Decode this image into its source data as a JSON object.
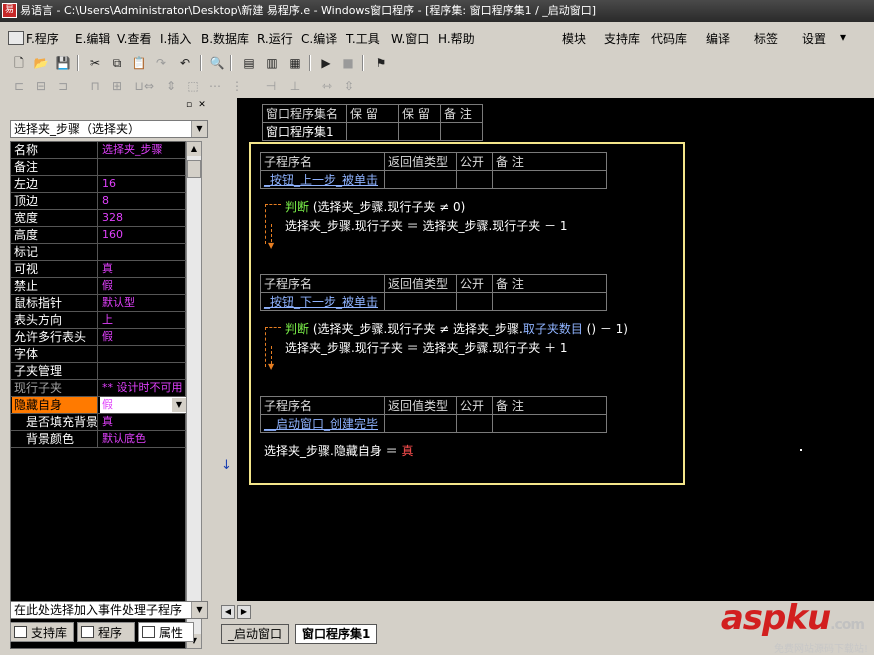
{
  "window": {
    "title": "易语言 - C:\\Users\\Administrator\\Desktop\\新建 易程序.e - Windows窗口程序 - [程序集: 窗口程序集1 / _启动窗口]",
    "app_icon": "易"
  },
  "menu": {
    "items": [
      {
        "label": "F.程序"
      },
      {
        "label": "E.编辑"
      },
      {
        "label": "V.查看"
      },
      {
        "label": "I.插入"
      },
      {
        "label": "B.数据库"
      },
      {
        "label": "R.运行"
      },
      {
        "label": "C.编译"
      },
      {
        "label": "T.工具"
      },
      {
        "label": "W.窗口"
      },
      {
        "label": "H.帮助"
      }
    ],
    "right_items": [
      {
        "label": "模块"
      },
      {
        "label": "支持库"
      },
      {
        "label": "代码库"
      },
      {
        "label": "编译"
      },
      {
        "label": "标签"
      },
      {
        "label": "设置"
      },
      {
        "label": "▾"
      }
    ]
  },
  "property_panel": {
    "object_selector": "选择夹_步骤（选择夹）",
    "rows": [
      {
        "key": "名称",
        "value": "选择夹_步骤"
      },
      {
        "key": "备注",
        "value": ""
      },
      {
        "key": "左边",
        "value": "16"
      },
      {
        "key": "顶边",
        "value": "8"
      },
      {
        "key": "宽度",
        "value": "328"
      },
      {
        "key": "高度",
        "value": "160"
      },
      {
        "key": "标记",
        "value": ""
      },
      {
        "key": "可视",
        "value": "真"
      },
      {
        "key": "禁止",
        "value": "假"
      },
      {
        "key": "鼠标指针",
        "value": "默认型"
      },
      {
        "key": "表头方向",
        "value": "上"
      },
      {
        "key": "允许多行表头",
        "value": "假"
      },
      {
        "key": "字体",
        "value": ""
      },
      {
        "key": "子夹管理",
        "value": ""
      },
      {
        "key": "现行子夹",
        "value": "** 设计时不可用"
      },
      {
        "key": "隐藏自身",
        "value": "假"
      },
      {
        "key": "是否填充背景",
        "value": "真"
      },
      {
        "key": "背景颜色",
        "value": "默认底色"
      }
    ],
    "event_selector": "在此处选择加入事件处理子程序",
    "tabs": [
      {
        "label": "支持库"
      },
      {
        "label": "程序"
      },
      {
        "label": "属性"
      }
    ]
  },
  "editor": {
    "assembly_table": {
      "headers": [
        "窗口程序集名",
        "保 留",
        "保 留",
        "备 注"
      ],
      "row": [
        "窗口程序集1",
        "",
        "",
        ""
      ]
    },
    "sub_header": [
      "子程序名",
      "返回值类型",
      "公开",
      "备 注"
    ],
    "subs": [
      {
        "name": "_按钮_上一步_被单击",
        "line1": {
          "kw": "判断",
          "rest": " (选择夹_步骤.现行子夹 ≠ 0)"
        },
        "line2": "选择夹_步骤.现行子夹 ＝ 选择夹_步骤.现行子夹 － 1"
      },
      {
        "name": "_按钮_下一步_被单击",
        "line1": {
          "kw": "判断",
          "rest_a": " (选择夹_步骤.现行子夹 ≠ 选择夹_步骤.",
          "fn": "取子夹数目",
          "rest_b": " () － 1)"
        },
        "line2": "选择夹_步骤.现行子夹 ＝ 选择夹_步骤.现行子夹 ＋ 1"
      },
      {
        "name": "__启动窗口_创建完毕",
        "line_a": "选择夹_步骤.隐藏自身 ＝ ",
        "line_b": "真"
      }
    ]
  },
  "editor_tabs": [
    {
      "label": "_启动窗口"
    },
    {
      "label": "窗口程序集1"
    }
  ],
  "watermark": {
    "brand": "aspku",
    "domain": ".com",
    "sub": "免费网站源码下载站!"
  },
  "colors": {
    "editor_bg": "#000000",
    "highlight_box": "#f3e58a",
    "selected_row": "#ff7a00",
    "property_value": "#e040fb"
  }
}
